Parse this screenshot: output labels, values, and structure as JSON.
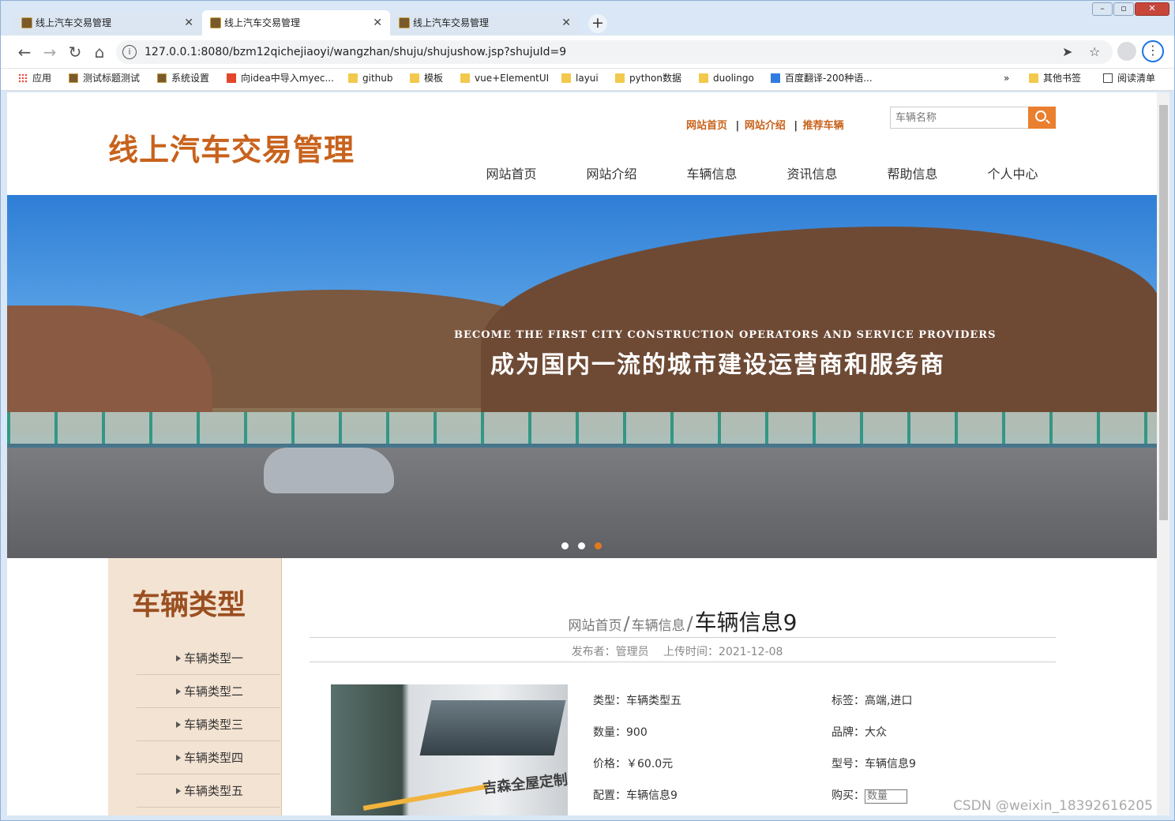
{
  "browser": {
    "tabs": [
      {
        "title": "线上汽车交易管理"
      },
      {
        "title": "线上汽车交易管理"
      },
      {
        "title": "线上汽车交易管理"
      }
    ],
    "url": "127.0.0.1:8080/bzm12qichejiaoyi/wangzhan/shuju/shujushow.jsp?shujuId=9",
    "bookmarks": [
      {
        "label": "应用"
      },
      {
        "label": "测试标题测试"
      },
      {
        "label": "系统设置"
      },
      {
        "label": "向idea中导入myec..."
      },
      {
        "label": "github"
      },
      {
        "label": "模板"
      },
      {
        "label": "vue+ElementUI"
      },
      {
        "label": "layui"
      },
      {
        "label": "python数据"
      },
      {
        "label": "duolingo"
      },
      {
        "label": "百度翻译-200种语..."
      },
      {
        "label": "»"
      },
      {
        "label": "其他书签"
      },
      {
        "label": "阅读清单"
      }
    ]
  },
  "site": {
    "logo": "线上汽车交易管理",
    "toplinks": [
      "网站首页",
      "网站介绍",
      "推荐车辆"
    ],
    "toplink_sep": "|",
    "search_placeholder": "车辆名称",
    "nav": [
      "网站首页",
      "网站介绍",
      "车辆信息",
      "资讯信息",
      "帮助信息",
      "个人中心"
    ],
    "banner": {
      "en": "BECOME THE FIRST CITY CONSTRUCTION OPERATORS AND SERVICE PROVIDERS",
      "cn": "成为国内一流的城市建设运营商和服务商",
      "active_slide": 3,
      "slide_count": 3
    },
    "sidebar": {
      "title": "车辆类型",
      "items": [
        "车辆类型一",
        "车辆类型二",
        "车辆类型三",
        "车辆类型四",
        "车辆类型五"
      ]
    },
    "detail": {
      "crumb_home": "网站首页",
      "crumb_section": "车辆信息",
      "crumb_current": "车辆信息9",
      "crumb_sep": "/",
      "publisher": "发布者：管理员",
      "upload_time": "上传时间：2021-12-08",
      "photo_text": "吉森全屋定制",
      "specs": {
        "type": "类型：车辆类型五",
        "tags": "标签：高端,进口",
        "quantity": "数量：900",
        "brand": "品牌：大众",
        "price": "价格：￥60.0元",
        "model": "型号：车辆信息9",
        "config": "配置：车辆信息9",
        "buy_label": "购买：",
        "buy_placeholder": "数量"
      }
    }
  },
  "watermark": "CSDN @weixin_18392616205"
}
